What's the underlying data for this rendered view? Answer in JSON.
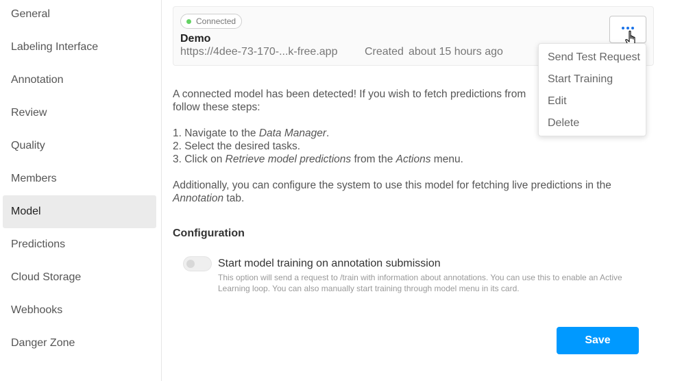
{
  "sidebar": {
    "items": [
      {
        "label": "General"
      },
      {
        "label": "Labeling Interface"
      },
      {
        "label": "Annotation"
      },
      {
        "label": "Review"
      },
      {
        "label": "Quality"
      },
      {
        "label": "Members"
      },
      {
        "label": "Model",
        "active": true
      },
      {
        "label": "Predictions"
      },
      {
        "label": "Cloud Storage"
      },
      {
        "label": "Webhooks"
      },
      {
        "label": "Danger Zone"
      }
    ]
  },
  "model_card": {
    "status": "Connected",
    "status_color": "#64d264",
    "name": "Demo",
    "url": "https://4dee-73-170-...k-free.app",
    "created_label": "Created",
    "created_value": "about 15 hours ago",
    "menu_icon": "more-horizontal-icon"
  },
  "dropdown": {
    "items": [
      {
        "label": "Send Test Request"
      },
      {
        "label": "Start Training"
      },
      {
        "label": "Edit"
      },
      {
        "label": "Delete"
      }
    ]
  },
  "description": {
    "line1": "A connected model has been detected! If you wish to fetch predictions from",
    "line2": "follow these steps:",
    "step1_prefix": "1. Navigate to the ",
    "step1_em": "Data Manager",
    "step1_suffix": ".",
    "step2": "2. Select the desired tasks.",
    "step3_prefix": "3. Click on ",
    "step3_em1": "Retrieve model predictions",
    "step3_mid": " from the ",
    "step3_em2": "Actions",
    "step3_suffix": " menu.",
    "extra_line1": "Additionally, you can configure the system to use this model for fetching live predictions in the",
    "extra_em": "Annotation",
    "extra_suffix": " tab."
  },
  "configuration": {
    "title": "Configuration",
    "toggle_label": "Start model training on annotation submission",
    "toggle_help": "This option will send a request to /train with information about annotations. You can use this to enable an Active Learning loop. You can also manually start training through model menu in its card.",
    "toggle_on": false
  },
  "actions": {
    "save_label": "Save",
    "save_color": "#0099ff"
  }
}
